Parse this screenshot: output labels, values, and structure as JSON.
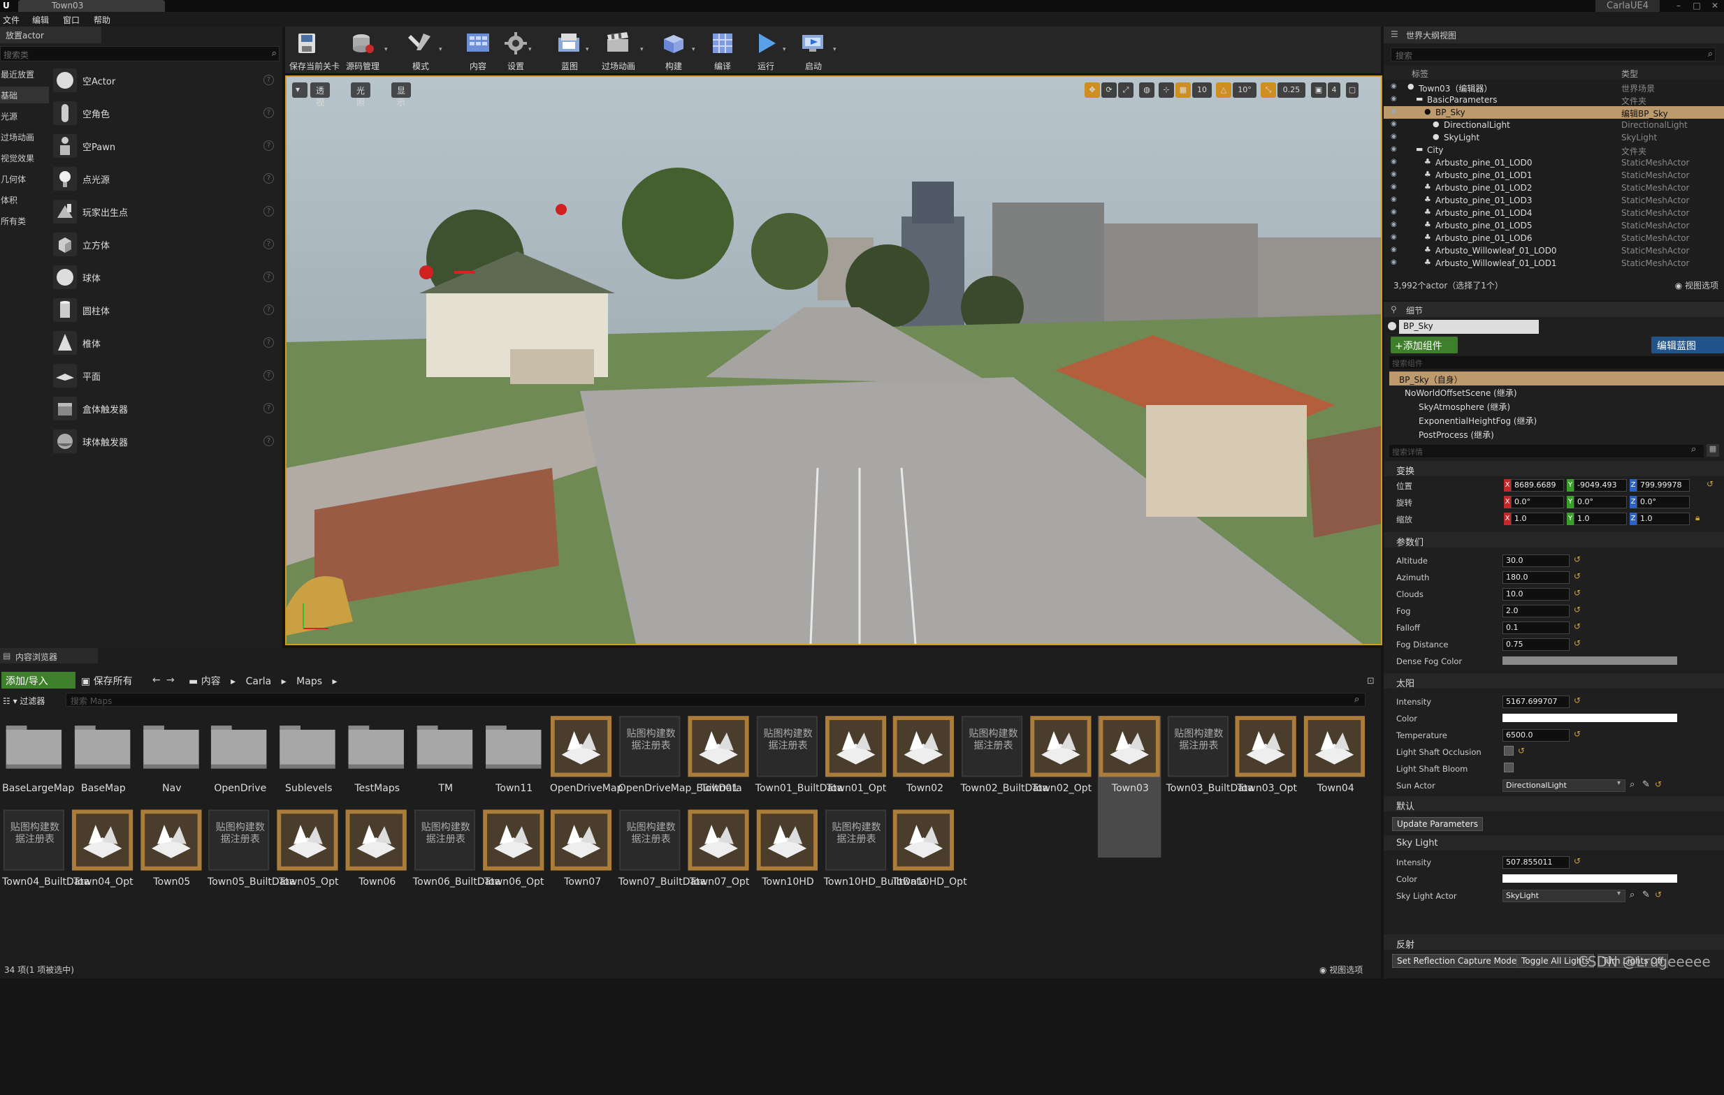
{
  "window": {
    "doc_tab": "Town03",
    "project": "CarlaUE4"
  },
  "menu": [
    "文件",
    "编辑",
    "窗口",
    "帮助"
  ],
  "place_actor": {
    "tab": "放置actor",
    "search_placeholder": "搜索类",
    "categories": [
      "最近放置",
      "基础",
      "光源",
      "过场动画",
      "视觉效果",
      "几何体",
      "体积",
      "所有类"
    ],
    "active_category": "基础",
    "actors": [
      "空Actor",
      "空角色",
      "空Pawn",
      "点光源",
      "玩家出生点",
      "立方体",
      "球体",
      "圆柱体",
      "椎体",
      "平面",
      "盒体触发器",
      "球体触发器"
    ],
    "help_glyph": "?"
  },
  "toolbar": {
    "buttons": [
      {
        "label": "保存当前关卡",
        "icon": "save-icon"
      },
      {
        "label": "源码管理",
        "icon": "source-control-icon"
      },
      {
        "label": "模式",
        "icon": "modes-icon"
      },
      {
        "label": "内容",
        "icon": "content-icon"
      },
      {
        "label": "设置",
        "icon": "settings-icon"
      },
      {
        "label": "蓝图",
        "icon": "blueprint-icon"
      },
      {
        "label": "过场动画",
        "icon": "cinematics-icon"
      },
      {
        "label": "构建",
        "icon": "build-icon"
      },
      {
        "label": "编译",
        "icon": "compile-icon"
      },
      {
        "label": "运行",
        "icon": "play-icon"
      },
      {
        "label": "启动",
        "icon": "launch-icon"
      }
    ]
  },
  "viewport": {
    "view_mode": "透视",
    "lit_mode": "光照",
    "show": "显示",
    "grid_snap": "10",
    "rotation_snap": "10°",
    "scale_snap": "0.25",
    "camera_speed": "4"
  },
  "outliner": {
    "tab": "世界大纲视图",
    "search_placeholder": "搜索",
    "col_label": "标签",
    "col_type": "类型",
    "rows": [
      {
        "label": "Town03（编辑器）",
        "type": "世界场景",
        "indent": 0
      },
      {
        "label": "BasicParameters",
        "type": "文件夹",
        "indent": 1
      },
      {
        "label": "BP_Sky",
        "type": "编辑BP_Sky",
        "indent": 2,
        "selected": true
      },
      {
        "label": "DirectionalLight",
        "type": "DirectionalLight",
        "indent": 3
      },
      {
        "label": "SkyLight",
        "type": "SkyLight",
        "indent": 3
      },
      {
        "label": "City",
        "type": "文件夹",
        "indent": 1
      },
      {
        "label": "Arbusto_pine_01_LOD0",
        "type": "StaticMeshActor",
        "indent": 2
      },
      {
        "label": "Arbusto_pine_01_LOD1",
        "type": "StaticMeshActor",
        "indent": 2
      },
      {
        "label": "Arbusto_pine_01_LOD2",
        "type": "StaticMeshActor",
        "indent": 2
      },
      {
        "label": "Arbusto_pine_01_LOD3",
        "type": "StaticMeshActor",
        "indent": 2
      },
      {
        "label": "Arbusto_pine_01_LOD4",
        "type": "StaticMeshActor",
        "indent": 2
      },
      {
        "label": "Arbusto_pine_01_LOD5",
        "type": "StaticMeshActor",
        "indent": 2
      },
      {
        "label": "Arbusto_pine_01_LOD6",
        "type": "StaticMeshActor",
        "indent": 2
      },
      {
        "label": "Arbusto_Willowleaf_01_LOD0",
        "type": "StaticMeshActor",
        "indent": 2
      },
      {
        "label": "Arbusto_Willowleaf_01_LOD1",
        "type": "StaticMeshActor",
        "indent": 2
      }
    ],
    "status": "3,992个actor（选择了1个）",
    "view_options": "视图选项"
  },
  "details": {
    "tab": "细节",
    "actor_name": "BP_Sky",
    "add_component": "+添加组件",
    "edit_blueprint": "编辑蓝图",
    "component_search_placeholder": "搜索组件",
    "root_component": "BP_Sky（自身）",
    "components": [
      "NoWorldOffsetScene (继承)",
      "SkyAtmosphere (继承)",
      "ExponentialHeightFog (继承)",
      "PostProcess (继承)"
    ],
    "details_search_placeholder": "搜索详情",
    "transform": {
      "title": "变换",
      "location_label": "位置",
      "rotation_label": "旋转",
      "scale_label": "缩放",
      "location": [
        "8689.6689",
        "-9049.493",
        "799.99978"
      ],
      "rotation": [
        "0.0°",
        "0.0°",
        "0.0°"
      ],
      "scale": [
        "1.0",
        "1.0",
        "1.0"
      ]
    },
    "params": {
      "title": "参数们",
      "altitude_label": "Altitude",
      "altitude": "30.0",
      "azimuth_label": "Azimuth",
      "azimuth": "180.0",
      "clouds_label": "Clouds",
      "clouds": "10.0",
      "fog_label": "Fog",
      "fog": "2.0",
      "falloff_label": "Falloff",
      "falloff": "0.1",
      "fog_distance_label": "Fog Distance",
      "fog_distance": "0.75",
      "dense_fog_color_label": "Dense Fog Color"
    },
    "sun": {
      "title": "太阳",
      "intensity_label": "Intensity",
      "intensity": "5167.699707",
      "color_label": "Color",
      "temperature_label": "Temperature",
      "temperature": "6500.0",
      "light_shaft_occlusion_label": "Light Shaft Occlusion",
      "light_shaft_bloom_label": "Light Shaft Bloom",
      "sun_actor_label": "Sun Actor",
      "sun_actor": "DirectionalLight"
    },
    "default": {
      "title": "默认",
      "update_button": "Update Parameters"
    },
    "sky_light": {
      "title": "Sky Light",
      "intensity_label": "Intensity",
      "intensity": "507.855011",
      "color_label": "Color",
      "actor_label": "Sky Light Actor",
      "actor": "SkyLight"
    },
    "reflection": {
      "title": "反射",
      "buttons": [
        "Set Reflection Capture Mode",
        "Toggle All Lights",
        "Turn Lights Off"
      ]
    }
  },
  "content_browser": {
    "tab": "内容浏览器",
    "import_button": "添加/导入",
    "save_all": "保存所有",
    "path": [
      "内容",
      "Carla",
      "Maps"
    ],
    "filter_button": "过滤器",
    "search_placeholder": "搜索 Maps",
    "assets_row1": [
      {
        "name": "BaseLargeMap",
        "kind": "folder"
      },
      {
        "name": "BaseMap",
        "kind": "folder"
      },
      {
        "name": "Nav",
        "kind": "folder"
      },
      {
        "name": "OpenDrive",
        "kind": "folder"
      },
      {
        "name": "Sublevels",
        "kind": "folder"
      },
      {
        "name": "TestMaps",
        "kind": "folder"
      },
      {
        "name": "TM",
        "kind": "folder"
      },
      {
        "name": "Town11",
        "kind": "folder"
      },
      {
        "name": "OpenDriveMap",
        "kind": "map"
      },
      {
        "name": "OpenDriveMap_BuiltData",
        "kind": "data"
      },
      {
        "name": "Town01",
        "kind": "map"
      },
      {
        "name": "Town01_BuiltData",
        "kind": "data"
      },
      {
        "name": "Town01_Opt",
        "kind": "map"
      },
      {
        "name": "Town02",
        "kind": "map"
      },
      {
        "name": "Town02_BuiltData",
        "kind": "data"
      },
      {
        "name": "Town02_Opt",
        "kind": "map"
      },
      {
        "name": "Town03",
        "kind": "map",
        "selected": true
      },
      {
        "name": "Town03_BuiltData",
        "kind": "data"
      },
      {
        "name": "Town03_Opt",
        "kind": "map"
      },
      {
        "name": "Town04",
        "kind": "map"
      }
    ],
    "assets_row2": [
      {
        "name": "Town04_BuiltData",
        "kind": "data"
      },
      {
        "name": "Town04_Opt",
        "kind": "map"
      },
      {
        "name": "Town05",
        "kind": "map"
      },
      {
        "name": "Town05_BuiltData",
        "kind": "data"
      },
      {
        "name": "Town05_Opt",
        "kind": "map"
      },
      {
        "name": "Town06",
        "kind": "map"
      },
      {
        "name": "Town06_BuiltData",
        "kind": "data"
      },
      {
        "name": "Town06_Opt",
        "kind": "map"
      },
      {
        "name": "Town07",
        "kind": "map"
      },
      {
        "name": "Town07_BuiltData",
        "kind": "data"
      },
      {
        "name": "Town07_Opt",
        "kind": "map"
      },
      {
        "name": "Town10HD",
        "kind": "map"
      },
      {
        "name": "Town10HD_BuiltData",
        "kind": "data"
      },
      {
        "name": "Town10HD_Opt",
        "kind": "map"
      }
    ],
    "data_thumb_text": "贴图构建数据注册表",
    "status": "34 项(1 项被选中)",
    "view_options": "视图选项"
  },
  "watermark": "CSDN @Lrugeeeee"
}
